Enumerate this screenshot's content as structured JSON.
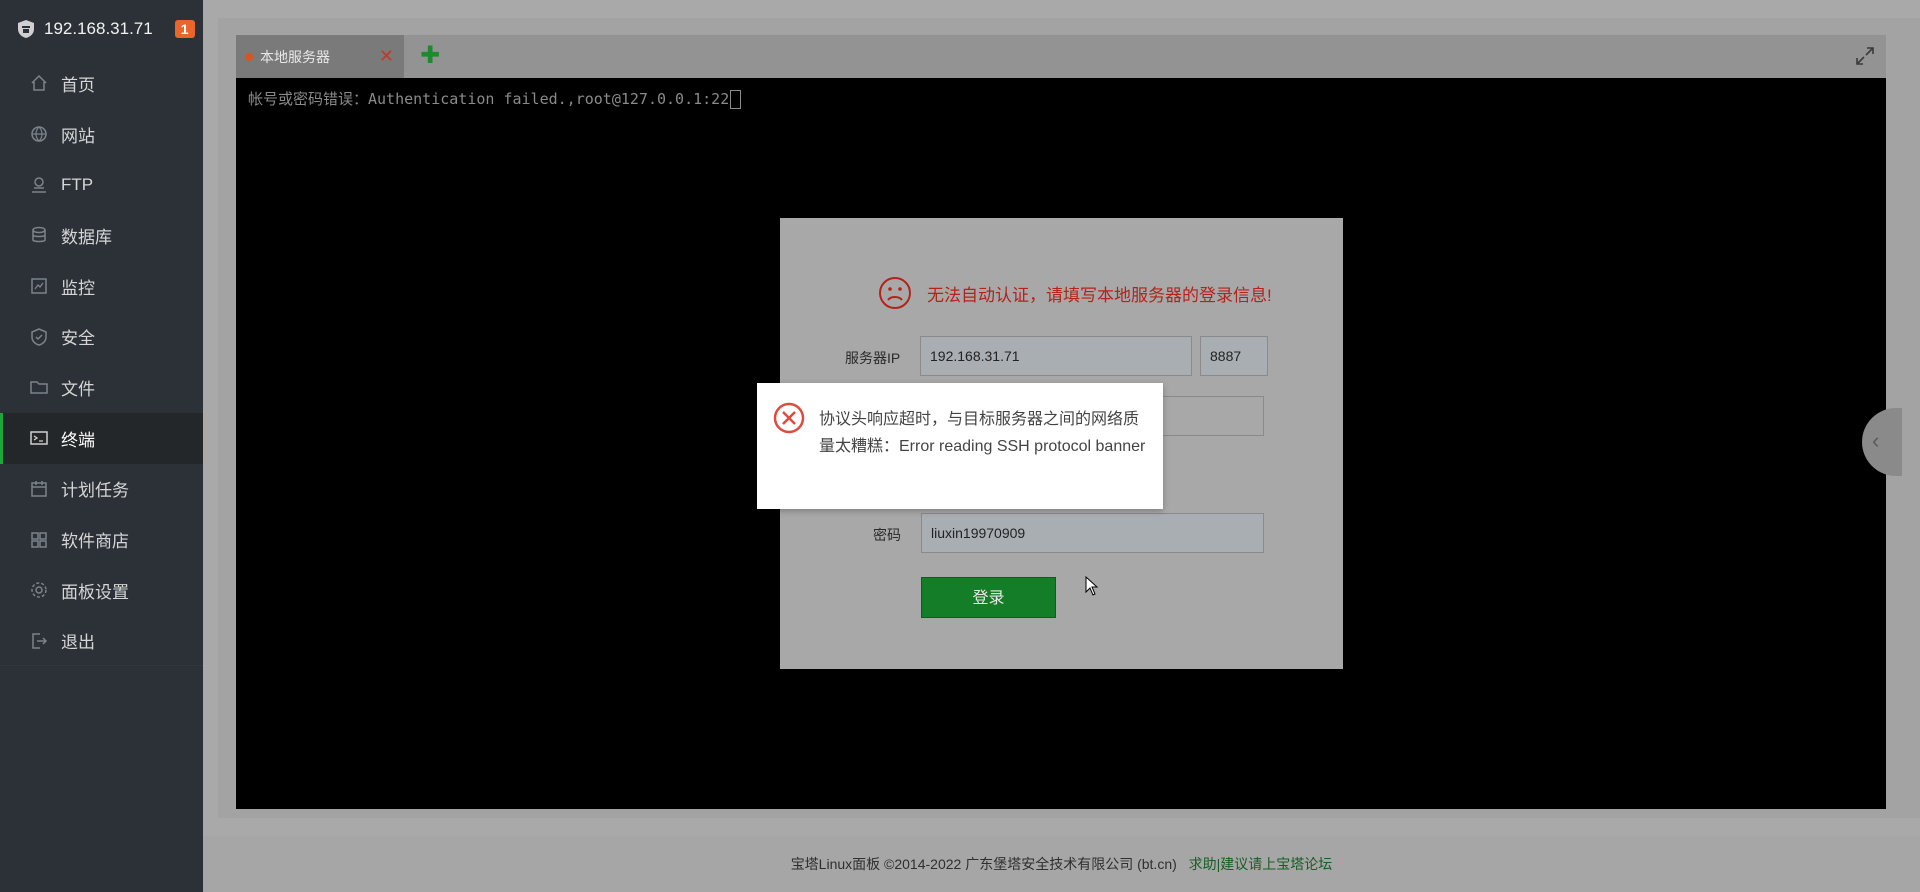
{
  "sidebar": {
    "server_ip": "192.168.31.71",
    "badge_count": "1",
    "items": [
      {
        "label": "首页",
        "icon": "home-icon"
      },
      {
        "label": "网站",
        "icon": "globe-icon"
      },
      {
        "label": "FTP",
        "icon": "ftp-icon"
      },
      {
        "label": "数据库",
        "icon": "database-icon"
      },
      {
        "label": "监控",
        "icon": "monitor-icon"
      },
      {
        "label": "安全",
        "icon": "shield-icon"
      },
      {
        "label": "文件",
        "icon": "folder-icon"
      },
      {
        "label": "终端",
        "icon": "terminal-icon"
      },
      {
        "label": "计划任务",
        "icon": "calendar-icon"
      },
      {
        "label": "软件商店",
        "icon": "apps-icon"
      },
      {
        "label": "面板设置",
        "icon": "gear-icon"
      },
      {
        "label": "退出",
        "icon": "logout-icon"
      }
    ],
    "active_item": "终端"
  },
  "tabs": {
    "items": [
      {
        "label": "本地服务器",
        "close_glyph": "✕"
      }
    ],
    "add_glyph": "✚"
  },
  "terminal": {
    "line": "帐号或密码错误：Authentication failed.,root@127.0.0.1:22"
  },
  "login_dialog": {
    "message": "无法自动认证，请填写本地服务器的登录信息!",
    "server_ip_label": "服务器IP",
    "server_ip_value": "192.168.31.71",
    "port_value": "8887",
    "password_label": "密码",
    "password_value": "liuxin19970909",
    "login_button": "登录"
  },
  "error_toast": {
    "message": "协议头响应超时，与目标服务器之间的网络质量太糟糕：Error reading SSH protocol banner"
  },
  "footer": {
    "copyright": "宝塔Linux面板 ©2014-2022 广东堡塔安全技术有限公司 (bt.cn)",
    "link": "求助|建议请上宝塔论坛"
  },
  "colors": {
    "sidebar_bg": "#2c3138",
    "accent_green": "#20a53a",
    "error_red": "#b5221a",
    "badge_orange": "#e8662c"
  }
}
